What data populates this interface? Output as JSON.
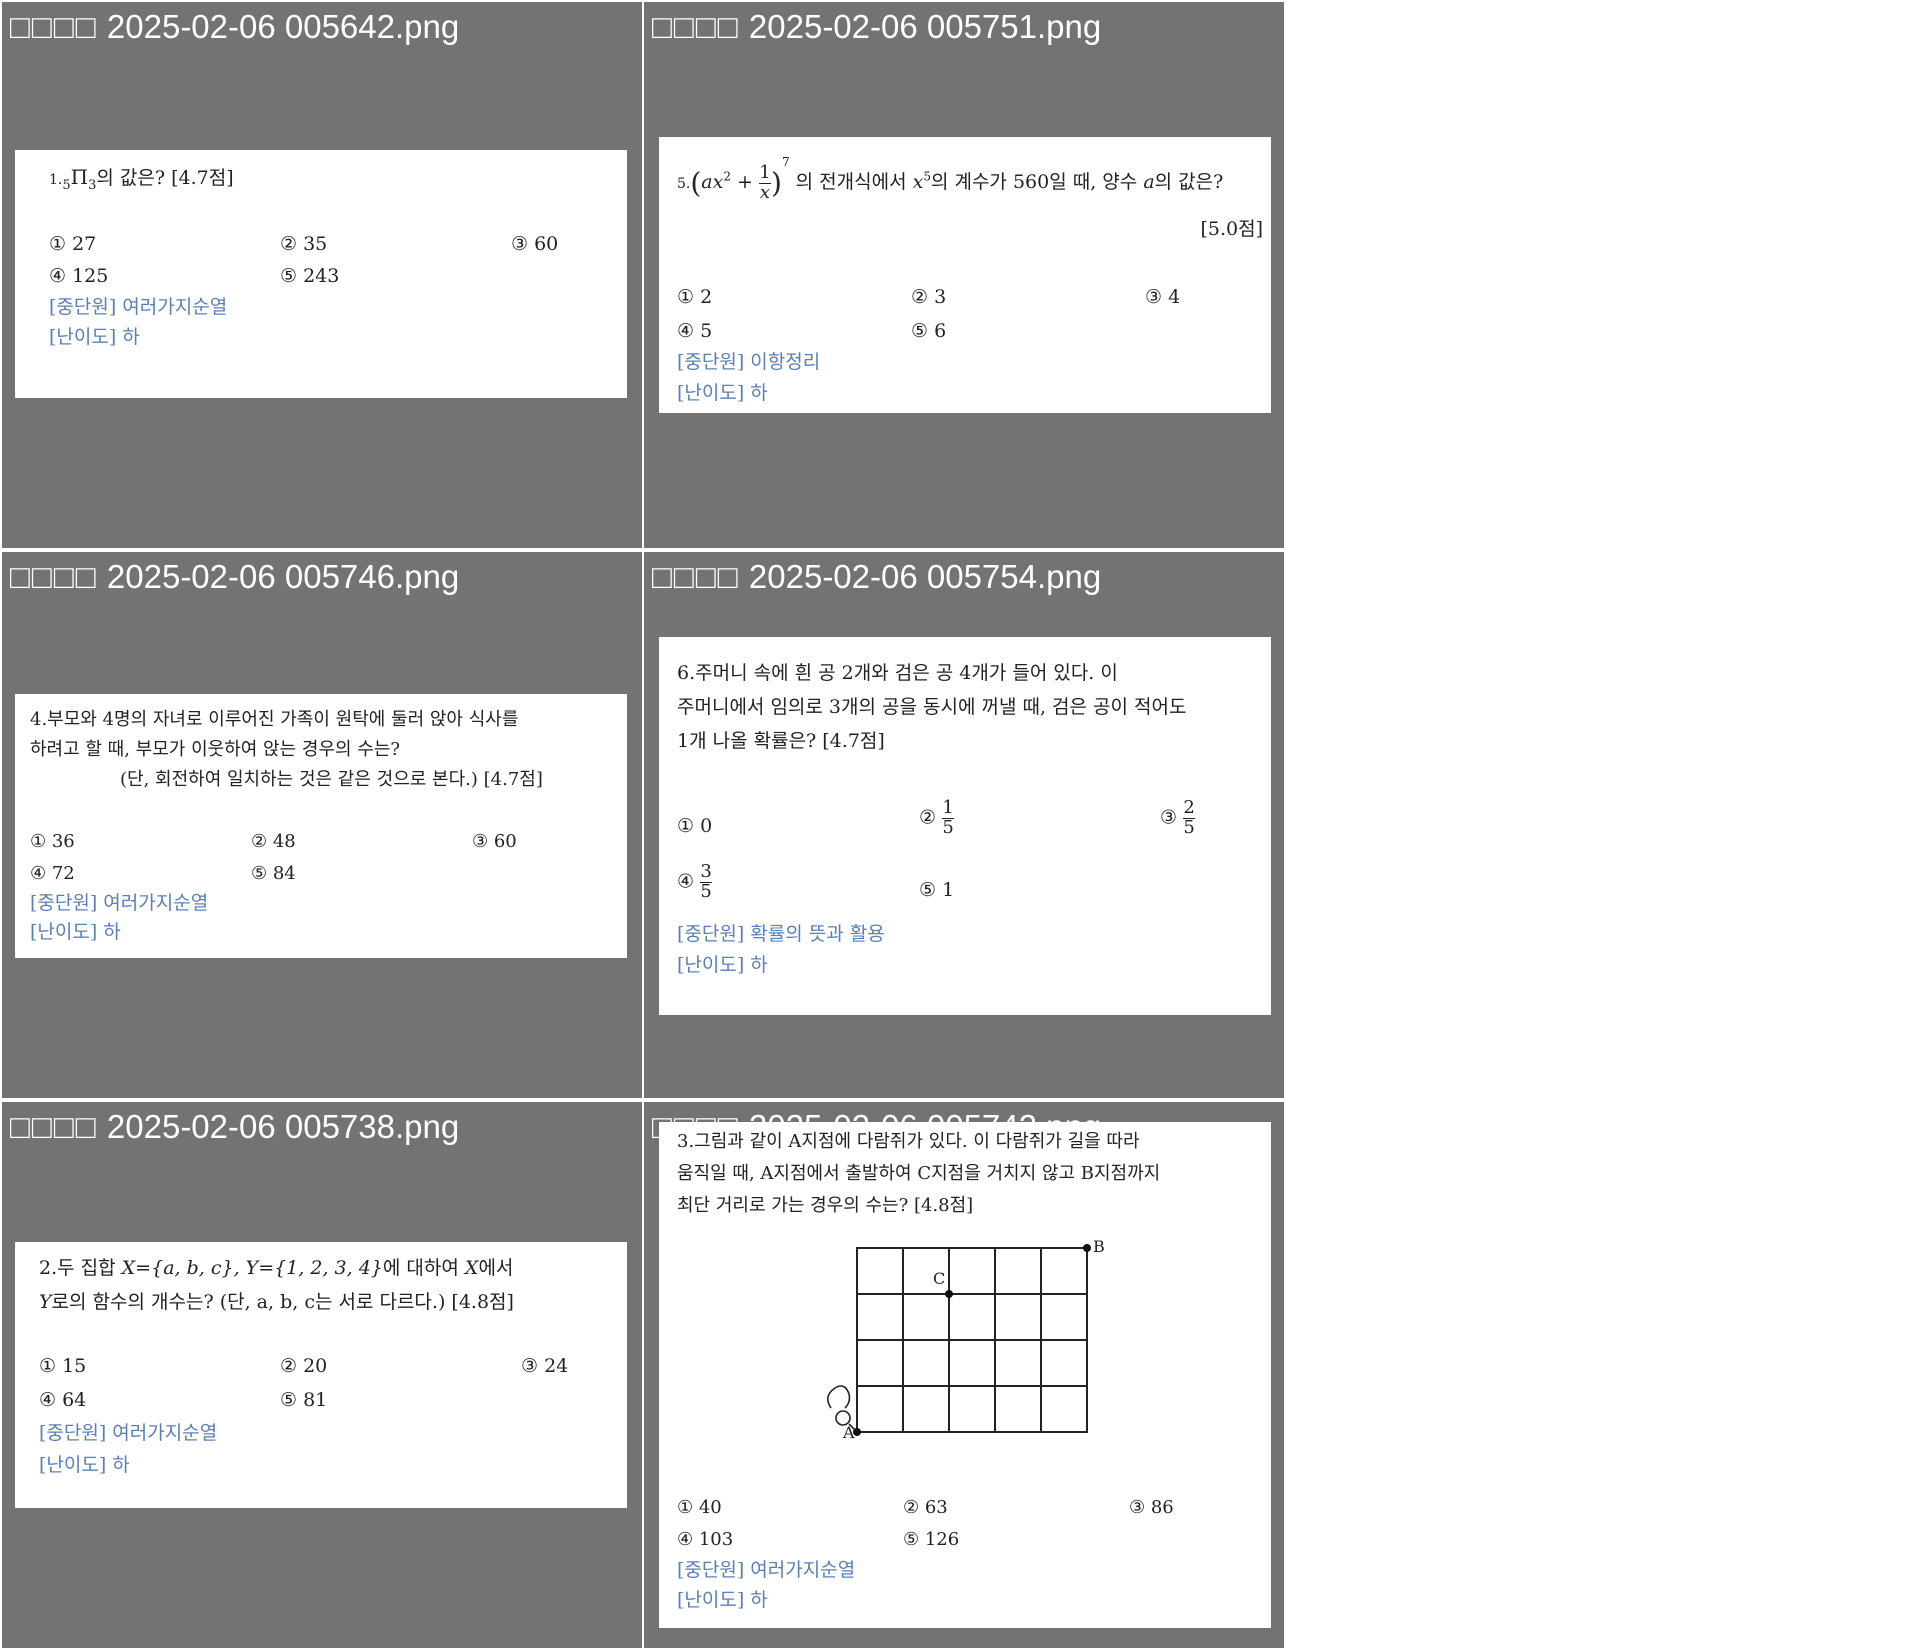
{
  "tiles": [
    {
      "title_prefix": "□□□□",
      "filename": "2025-02-06 005642.png",
      "question": {
        "number": "1.",
        "expr_sub_left": "5",
        "expr_main": "Π",
        "expr_sub_right": "3",
        "text": "의 값은? [4.7점]"
      },
      "choices": [
        "① 27",
        "② 35",
        "③ 60",
        "④ 125",
        "⑤ 243"
      ],
      "unit": "[중단원] 여러가지순열",
      "difficulty": "[난이도] 하"
    },
    {
      "title_prefix": "□□□□",
      "filename": "2025-02-06 005751.png",
      "question": {
        "number": "5.",
        "expr_a": "ax",
        "expr_sq": "2",
        "expr_plus": "+",
        "frac_num": "1",
        "frac_den": "x",
        "expr_pow": "7",
        "text1": "의 전개식에서",
        "term": "x",
        "term_pow": "5",
        "text2": "의 계수가 560일 때, 양수",
        "var_a": "a",
        "text3": "의 값은?",
        "points": "[5.0점]"
      },
      "choices": [
        "① 2",
        "② 3",
        "③ 4",
        "④ 5",
        "⑤ 6"
      ],
      "unit": "[중단원] 이항정리",
      "difficulty": "[난이도] 하"
    },
    {
      "title_prefix": "□□□□",
      "filename": "2025-02-06 005746.png",
      "question": {
        "line1": "4.부모와 4명의 자녀로 이루어진 가족이 원탁에 둘러 앉아 식사를",
        "line2": "하려고 할 때, 부모가 이웃하여 앉는 경우의 수는?",
        "line3": "(단, 회전하여 일치하는 것은 같은 것으로 본다.) [4.7점]"
      },
      "choices": [
        "① 36",
        "② 48",
        "③ 60",
        "④ 72",
        "⑤ 84"
      ],
      "unit": "[중단원] 여러가지순열",
      "difficulty": "[난이도] 하"
    },
    {
      "title_prefix": "□□□□",
      "filename": "2025-02-06 005754.png",
      "question": {
        "line1": "6.주머니 속에 흰 공 2개와 검은 공 4개가 들어 있다. 이",
        "line2": "주머니에서 임의로 3개의 공을 동시에 꺼낼 때, 검은 공이 적어도",
        "line3": "1개 나올 확률은?  [4.7점]"
      },
      "choices": {
        "c1": "① 0",
        "c2_label": "②",
        "c2_num": "1",
        "c2_den": "5",
        "c3_label": "③",
        "c3_num": "2",
        "c3_den": "5",
        "c4_label": "④",
        "c4_num": "3",
        "c4_den": "5",
        "c5": "⑤ 1"
      },
      "unit": "[중단원] 확률의 뜻과 활용",
      "difficulty": "[난이도] 하"
    },
    {
      "title_prefix": "□□□□",
      "filename": "2025-02-06 005738.png",
      "question": {
        "line1_a": "2.두 집합",
        "set_x": "X={a, b, c},",
        "set_y": "Y={1, 2, 3, 4}",
        "line1_b": "에 대하여",
        "var_x": "X",
        "line1_c": "에서",
        "var_y": "Y",
        "line2": "로의 함수의 개수는? (단, a, b, c는 서로 다르다.) [4.8점]"
      },
      "choices": [
        "① 15",
        "② 20",
        "③ 24",
        "④ 64",
        "⑤ 81"
      ],
      "unit": "[중단원] 여러가지순열",
      "difficulty": "[난이도] 하"
    },
    {
      "title_prefix": "□□□□",
      "filename": "2025-02-06 005742.png",
      "question": {
        "line1": "3.그림과 같이 A지점에 다람쥐가 있다. 이 다람쥐가 길을 따라",
        "line2": "움직일 때, A지점에서 출발하여 C지점을 거치지 않고 B지점까지",
        "line3": "최단 거리로 가는 경우의 수는? [4.8점]"
      },
      "figure": {
        "label_a": "A",
        "label_b": "B",
        "label_c": "C",
        "cols": 5,
        "rows": 4,
        "c_col": 2,
        "c_row": 3
      },
      "choices": [
        "① 40",
        "② 63",
        "③ 86",
        "④ 103",
        "⑤ 126"
      ],
      "unit": "[중단원] 여러가지순열",
      "difficulty": "[난이도] 하"
    }
  ]
}
